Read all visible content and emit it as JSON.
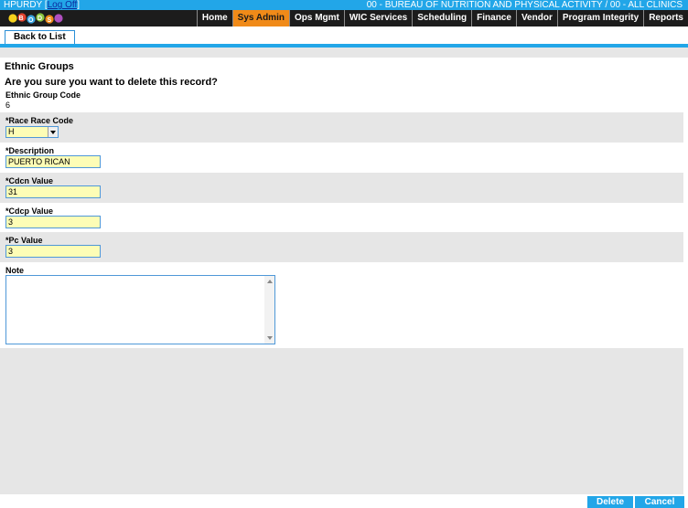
{
  "header": {
    "user": "HPURDY",
    "logoff_label": "Log Off",
    "org_path": "00 - BUREAU OF NUTRITION AND PHYSICAL ACTIVITY / 00 - ALL CLINICS",
    "logo_letters": [
      "B",
      "O",
      "D",
      "S"
    ]
  },
  "nav": {
    "items": [
      {
        "label": "Home"
      },
      {
        "label": "Sys Admin"
      },
      {
        "label": "Ops Mgmt"
      },
      {
        "label": "WIC Services"
      },
      {
        "label": "Scheduling"
      },
      {
        "label": "Finance"
      },
      {
        "label": "Vendor"
      },
      {
        "label": "Program Integrity"
      },
      {
        "label": "Reports"
      }
    ],
    "active": "Sys Admin"
  },
  "toolbar": {
    "back_label": "Back to List"
  },
  "page": {
    "title": "Ethnic Groups",
    "confirm_text": "Are you sure you want to delete this record?"
  },
  "form": {
    "ethnic_group_code": {
      "label": "Ethnic Group Code",
      "value": "6"
    },
    "race_code": {
      "label": "*Race Race Code",
      "value": "H"
    },
    "description": {
      "label": "*Description",
      "value": "PUERTO RICAN"
    },
    "cdcn": {
      "label": "*Cdcn Value",
      "value": "31"
    },
    "cdcp": {
      "label": "*Cdcp Value",
      "value": "3"
    },
    "pc": {
      "label": "*Pc Value",
      "value": "3"
    },
    "note": {
      "label": "Note",
      "value": ""
    }
  },
  "footer": {
    "delete_label": "Delete",
    "cancel_label": "Cancel"
  },
  "colors": {
    "accent": "#22a6e8",
    "active_tab": "#f08a18",
    "required_input": "#fdfdb6",
    "navbar": "#1c1c1c"
  }
}
